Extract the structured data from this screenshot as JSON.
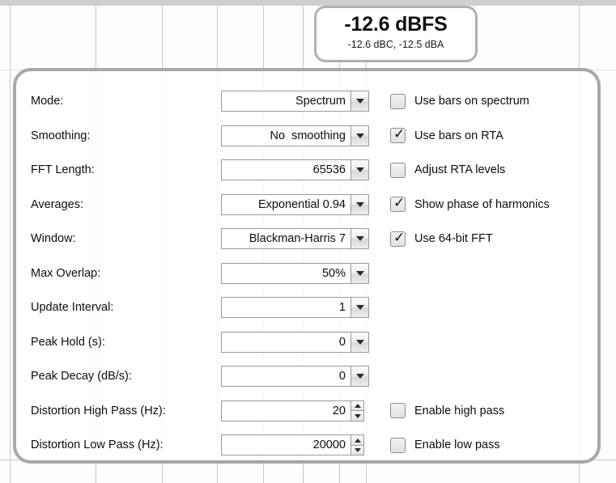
{
  "readout": {
    "primary": "-12.6 dBFS",
    "secondary": "-12.6 dBC, -12.5 dBA"
  },
  "settings": {
    "fields": [
      {
        "label": "Mode:",
        "value": "Spectrum",
        "control": "dropdown"
      },
      {
        "label": "Smoothing:",
        "value": "No  smoothing",
        "control": "dropdown"
      },
      {
        "label": "FFT Length:",
        "value": "65536",
        "control": "dropdown"
      },
      {
        "label": "Averages:",
        "value": "Exponential 0.94",
        "control": "dropdown"
      },
      {
        "label": "Window:",
        "value": "Blackman-Harris 7",
        "control": "dropdown"
      },
      {
        "label": "Max Overlap:",
        "value": "50%",
        "control": "dropdown"
      },
      {
        "label": "Update Interval:",
        "value": "1",
        "control": "dropdown"
      },
      {
        "label": "Peak Hold (s):",
        "value": "0",
        "control": "dropdown"
      },
      {
        "label": "Peak Decay (dB/s):",
        "value": "0",
        "control": "dropdown"
      },
      {
        "label": "Distortion High Pass (Hz):",
        "value": "20",
        "control": "spinner"
      },
      {
        "label": "Distortion Low Pass (Hz):",
        "value": "20000",
        "control": "spinner"
      }
    ],
    "checkboxes": [
      {
        "label": "Use bars on spectrum",
        "checked": false
      },
      {
        "label": "Use bars on RTA",
        "checked": true
      },
      {
        "label": "Adjust RTA levels",
        "checked": false
      },
      {
        "label": "Show phase of harmonics",
        "checked": true
      },
      {
        "label": "Use 64-bit FFT",
        "checked": true
      },
      {
        "label": "Enable high pass",
        "checked": false
      },
      {
        "label": "Enable low pass",
        "checked": false
      }
    ],
    "check_glyph": "✓"
  },
  "colors": {
    "panel_border": "#a8a8a8",
    "readout_border": "#b0b0b0",
    "gridline": "#c8c8c8",
    "text": "#0d0d0d"
  }
}
